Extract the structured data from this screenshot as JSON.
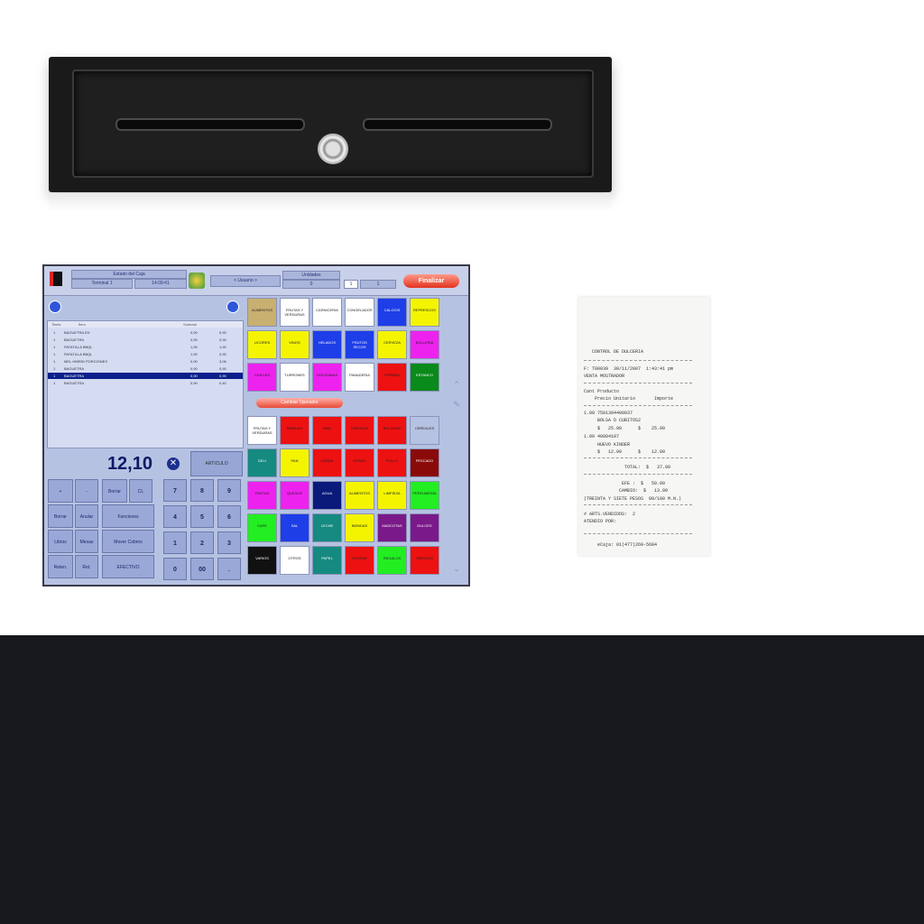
{
  "pos": {
    "header": {
      "station_label": "Estado del Caja",
      "terminal": "Terminal 1",
      "time": "14:09:41",
      "user_label": "< Usuario >",
      "qty_label": "Unidades",
      "qty_value": "0",
      "page_a": "1",
      "page_b": "1",
      "finalize_label": "Finalizar"
    },
    "list": {
      "headers": [
        "Tikets",
        "Ítem",
        "Subtotal"
      ],
      "rows": [
        {
          "qty": "1",
          "name": "BAGUETRA ED",
          "price": "0,90",
          "total": "0,90",
          "selected": false
        },
        {
          "qty": "1",
          "name": "BAGUETRA",
          "price": "0,90",
          "total": "0,90",
          "selected": false
        },
        {
          "qty": "1",
          "name": "PATATILLA BBQL",
          "price": "1,90",
          "total": "1,90",
          "selected": false
        },
        {
          "qty": "1",
          "name": "PATATILLA BBQL",
          "price": "1,90",
          "total": "0,90",
          "selected": false
        },
        {
          "qty": "1",
          "name": "MEL.HIBRID PORCIONES",
          "price": "0,90",
          "total": "3,06",
          "selected": false
        },
        {
          "qty": "1",
          "name": "BAGUETRA",
          "price": "0,90",
          "total": "0,90",
          "selected": false
        },
        {
          "qty": "1",
          "name": "BAGUETRA",
          "price": "0,90",
          "total": "0,90",
          "selected": true
        },
        {
          "qty": "1",
          "name": "BAGUETRA",
          "price": "0,90",
          "total": "0,40",
          "selected": false
        }
      ]
    },
    "total": "12,10",
    "article_label": "ARTICULO",
    "func_keys": [
      "+",
      "-",
      "Borrar Línea",
      "CL",
      "Borrar",
      "Anular",
      "Funciones",
      "Libros",
      "Mesas",
      "Mover Cobros",
      "Reten.",
      "Ret. Cliente",
      "EFECTIVO"
    ],
    "numpad": [
      "7",
      "8",
      "9",
      "4",
      "5",
      "6",
      "1",
      "2",
      "3",
      "0",
      "00",
      "."
    ],
    "tab_ops_label": "Cambiar Operador",
    "top_products": [
      {
        "label": "ALIMENTOS",
        "color": "#c8b070"
      },
      {
        "label": "FRUTAS Y VERDURAS",
        "color": "#ffffff"
      },
      {
        "label": "CARNICERIA",
        "color": "#ffffff"
      },
      {
        "label": "CONGELADOS",
        "color": "#ffffff"
      },
      {
        "label": "CALCIOS",
        "color": "#1e3ee8"
      },
      {
        "label": "REFRESCOS",
        "color": "#f4f400"
      },
      {
        "label": "LICORES",
        "color": "#f4f400"
      },
      {
        "label": "VINOS",
        "color": "#f4f400"
      },
      {
        "label": "HELADOS",
        "color": "#1e3ee8"
      },
      {
        "label": "FRUTOS SECOS",
        "color": "#1e3ee8"
      },
      {
        "label": "CERVEZA",
        "color": "#f4f400"
      },
      {
        "label": "BOLLERIA",
        "color": "#ee22ee"
      },
      {
        "label": "CHICLES",
        "color": "#ee22ee"
      },
      {
        "label": "TURRONES",
        "color": "#ffffff"
      },
      {
        "label": "GOLOSINAS",
        "color": "#ee22ee"
      },
      {
        "label": "PANADERIA",
        "color": "#ffffff"
      },
      {
        "label": "PRENSA",
        "color": "#ee1111"
      },
      {
        "label": "ESTANCO",
        "color": "#0a8a1a"
      }
    ],
    "bottom_products": [
      {
        "label": "FRUTAS Y VERDURAS",
        "color": "#ffffff"
      },
      {
        "label": "BEBIDAS",
        "color": "#ee1111"
      },
      {
        "label": "VINO",
        "color": "#ee1111"
      },
      {
        "label": "CERVEZA",
        "color": "#ee1111"
      },
      {
        "label": "BOLLERIA",
        "color": "#ee1111"
      },
      {
        "label": "CEREALES",
        "color": "#b6c2e2"
      },
      {
        "label": "DELI",
        "color": "#158a80"
      },
      {
        "label": "PAN",
        "color": "#f4f400"
      },
      {
        "label": "CARNE",
        "color": "#ee1111"
      },
      {
        "label": "CERDO",
        "color": "#ee1111"
      },
      {
        "label": "POLLO",
        "color": "#ee1111"
      },
      {
        "label": "PESCADO",
        "color": "#8a0a0a"
      },
      {
        "label": "PASTAS",
        "color": "#ee22ee"
      },
      {
        "label": "QUESOS",
        "color": "#ee22ee"
      },
      {
        "label": "AGUA",
        "color": "#0a1a7a"
      },
      {
        "label": "ALIMENTOS",
        "color": "#f4f400"
      },
      {
        "label": "LIMPIEZA",
        "color": "#f4f400"
      },
      {
        "label": "PERFUMERIA",
        "color": "#22ee22"
      },
      {
        "label": "CAFE",
        "color": "#22ee22"
      },
      {
        "label": "SAL",
        "color": "#1e3ee8"
      },
      {
        "label": "LECHE",
        "color": "#158a80"
      },
      {
        "label": "BEBIDAS",
        "color": "#f4f400"
      },
      {
        "label": "MASCOTAS",
        "color": "#7a1a8a"
      },
      {
        "label": "DULCES",
        "color": "#7a1a8a"
      },
      {
        "label": "VARIOS",
        "color": "#111111"
      },
      {
        "label": "OTROS",
        "color": "#ffffff"
      },
      {
        "label": "PAPEL",
        "color": "#158a80"
      },
      {
        "label": "HIGIENE",
        "color": "#ee1111"
      },
      {
        "label": "REGALOS",
        "color": "#22ee22"
      },
      {
        "label": "SERVICIO",
        "color": "#ee1111"
      }
    ]
  },
  "receipt": {
    "lines": [
      "   CONTROL DE DULCERIA",
      "F: T00039  30/11/2007  1:43:41 pm",
      "VENTA MOSTRADOR",
      "Cant Producto",
      "    Precio Unitario       Importe",
      "1.00 7501304400037",
      "     BOLSA D CUBITOS2",
      "     $   25.00      $    25.00",
      "1.00 40084107",
      "     HUEVO KINDER",
      "     $   12.00      $    12.00",
      "               TOTAL:  $   37.00",
      "              EFE :  $   50.00",
      "             CAMBIO:  $   13.00",
      "(TREINTA Y SIETE PESOS  00/100 M.N.)",
      "# ARTS.VENDIDOS:  2",
      "ATENDIO POR:",
      "     eCaja: 01(477)269-5684"
    ]
  }
}
